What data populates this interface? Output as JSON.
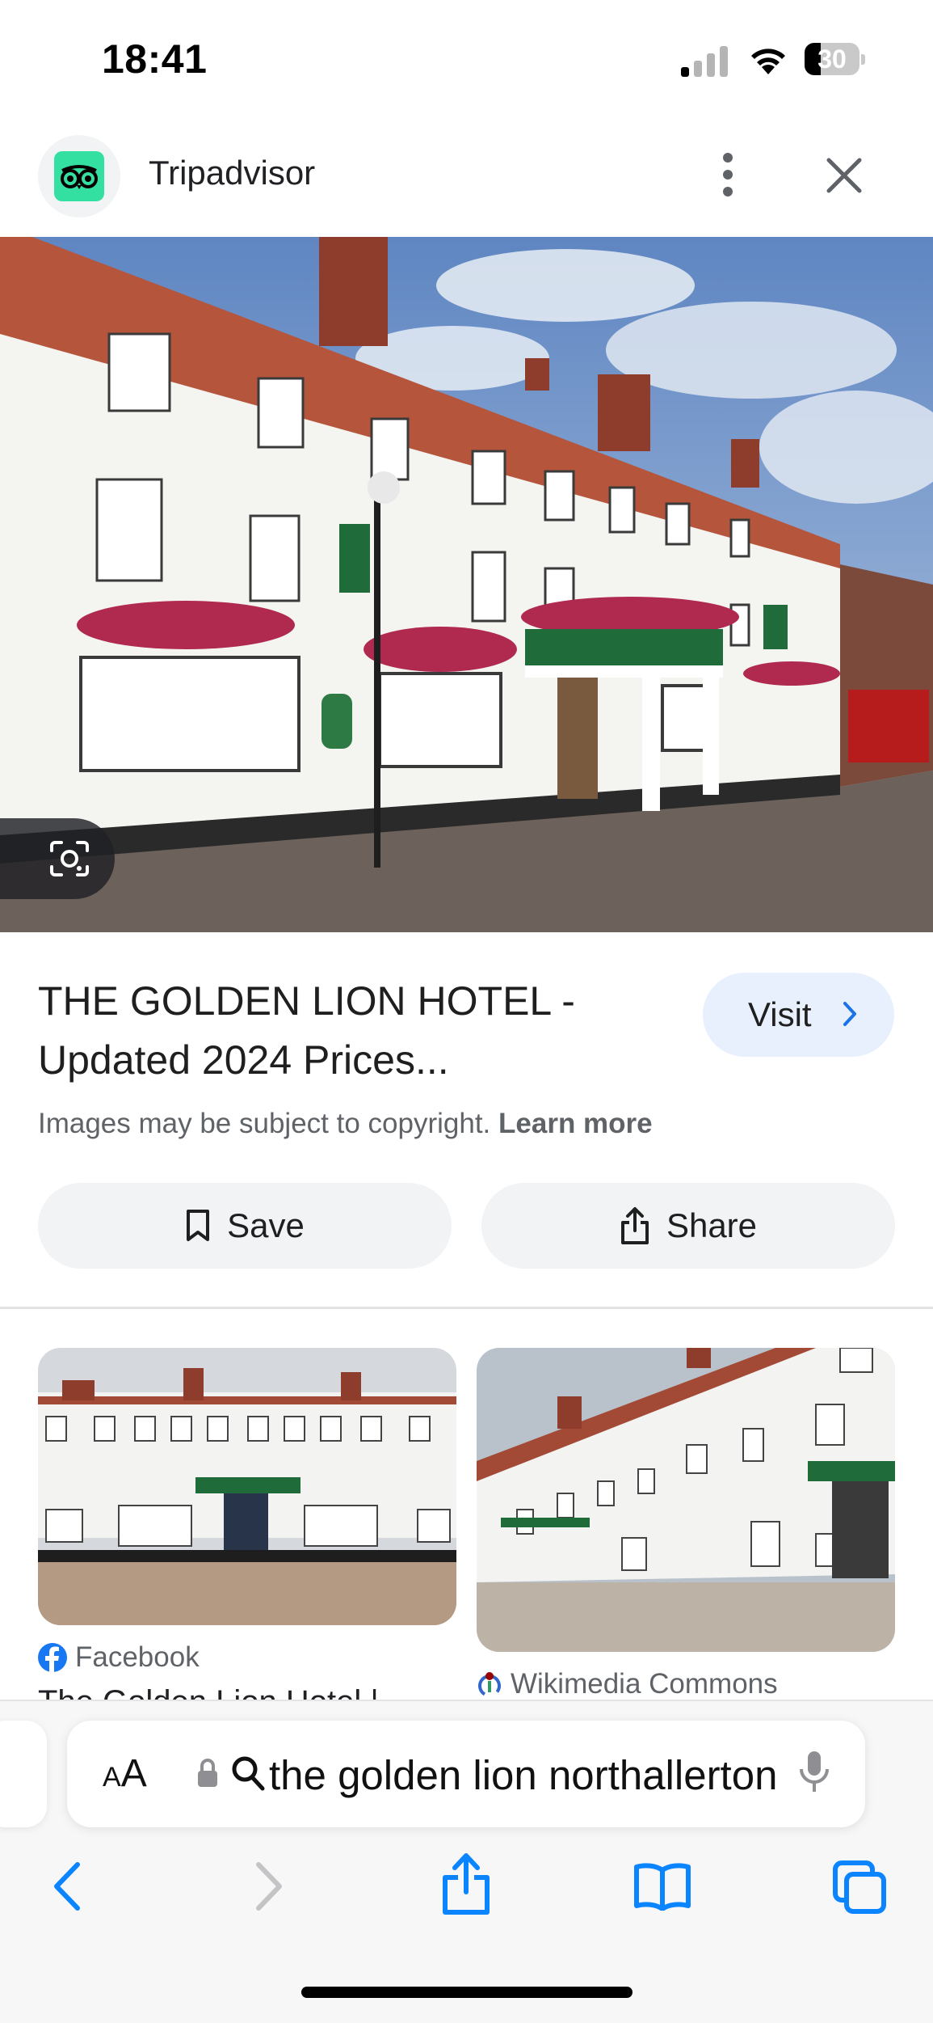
{
  "status_bar": {
    "time": "18:41",
    "battery_level": "30"
  },
  "header": {
    "source_name": "Tripadvisor",
    "source_icon": "tripadvisor-owl-icon"
  },
  "result": {
    "title": "THE GOLDEN LION HOTEL - Updated 2024 Prices...",
    "visit_label": "Visit",
    "copyright_text": "Images may be subject to copyright.",
    "learn_more_label": "Learn more",
    "save_label": "Save",
    "share_label": "Share"
  },
  "related": [
    {
      "source": "Facebook",
      "source_icon": "facebook-icon",
      "snippet": "The Golden Lion Hotel |"
    },
    {
      "source": "Wikimedia Commons",
      "source_icon": "wikimedia-icon"
    }
  ],
  "browser": {
    "aa_label_big": "A",
    "aa_label_small": "A",
    "url_text": "the golden lion northallerton"
  },
  "colors": {
    "accent": "#1a73e8",
    "visit_bg": "#e8f0fe",
    "tripadvisor_green": "#34e0a1",
    "safari_blue": "#0a84ff"
  }
}
